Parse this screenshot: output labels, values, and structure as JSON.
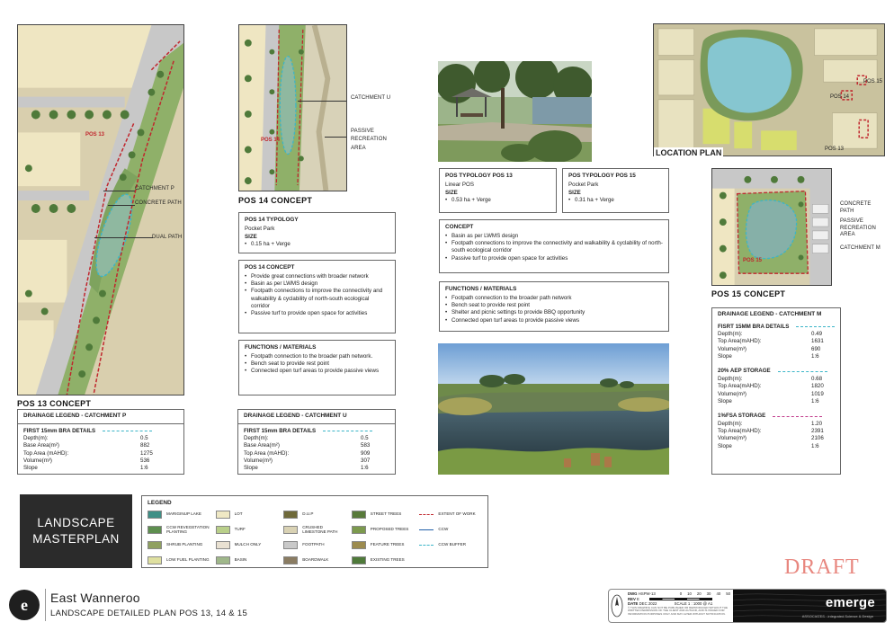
{
  "pos13": {
    "title": "POS 13 CONCEPT",
    "tag": "POS 13",
    "callouts": [
      "CATCHMENT P",
      "CONCRETE PATH",
      "DUAL PATH"
    ]
  },
  "pos14": {
    "title": "POS 14 CONCEPT",
    "tag": "POS 14",
    "callouts": [
      "CATCHMENT U",
      "PASSIVE RECREATION AREA"
    ],
    "typology": {
      "heading": "POS 14 TYPOLOGY",
      "type": "Pocket Park",
      "size_label": "SIZE",
      "size": "0.15 ha + Verge"
    },
    "concept": {
      "heading": "POS 14 CONCEPT",
      "items": [
        "Provide great connections with broader network",
        "Basin as per LWMS design",
        "Footpath connections to improve the connectivity and walkability & cyclability of north-south ecological corridor",
        "Passive turf to provide open space for activities"
      ]
    },
    "functions": {
      "heading": "FUNCTIONS / MATERIALS",
      "items": [
        "Footpath connection to the broader path network.",
        "Bench seat to provide rest point",
        "Connected open turf areas to provide passive views"
      ]
    }
  },
  "drainage_p": {
    "heading": "DRAINAGE LEGEND - CATCHMENT P",
    "sections": [
      {
        "title": "FIRST 15mm BRA DETAILS",
        "rows": [
          {
            "k": "Depth(m):",
            "v": "0.5"
          },
          {
            "k": "Base Area(m²)",
            "v": "882"
          },
          {
            "k": "Top Area (mAHD):",
            "v": "1275"
          },
          {
            "k": "Volume(m³)",
            "v": "536"
          },
          {
            "k": "Slope",
            "v": "1:6"
          }
        ]
      }
    ]
  },
  "drainage_u": {
    "heading": "DRAINAGE LEGEND - CATCHMENT U",
    "sections": [
      {
        "title": "FIRST 15mm BRA DETAILS",
        "rows": [
          {
            "k": "Depth(m):",
            "v": "0.5"
          },
          {
            "k": "Base Area(m²)",
            "v": "583"
          },
          {
            "k": "Top Area (mAHD):",
            "v": "909"
          },
          {
            "k": "Volume(m³)",
            "v": "307"
          },
          {
            "k": "Slope",
            "v": "1:6"
          }
        ]
      }
    ]
  },
  "typology13": {
    "heading": "POS TYPOLOGY POS 13",
    "type": "Linear POS",
    "size_label": "SIZE",
    "size": "0.53 ha + Verge"
  },
  "typology15": {
    "heading": "POS TYPOLOGY POS 15",
    "type": "Pocket Park",
    "size_label": "SIZE",
    "size": "0.31 ha + Verge"
  },
  "concept_shared": {
    "heading": "CONCEPT",
    "items": [
      "Basin as per LWMS design",
      "Footpath connections to improve the connectivity and walkability & cyclability of north-south ecological corridor",
      "Passive turf to provide open space for activities"
    ]
  },
  "functions_shared": {
    "heading": "FUNCTIONS / MATERIALS",
    "items": [
      "Footpath connection to the broader path network",
      "Bench seat to provide rest point",
      "Shelter and picnic settings to provide BBQ opportunity",
      "Connected open turf areas to provide passive views"
    ]
  },
  "location": {
    "title": "LOCATION PLAN",
    "tags": [
      "POS 15",
      "POS 14",
      "POS 13"
    ]
  },
  "pos15": {
    "title": "POS 15 CONCEPT",
    "tag": "POS 15",
    "callouts": [
      "CONCRETE PATH",
      "PASSIVE RECREATION AREA",
      "CATCHMENT M"
    ]
  },
  "drainage_m": {
    "heading": "DRAINAGE LEGEND - CATCHMENT M",
    "sections": [
      {
        "title": "FISRT 15MM BRA DETAILS",
        "style": "cyan",
        "rows": [
          {
            "k": "Depth(m):",
            "v": "0.49"
          },
          {
            "k": "Top Area(mAHD):",
            "v": "1631"
          },
          {
            "k": "Volume(m³)",
            "v": "690"
          },
          {
            "k": "Slope",
            "v": "1:6"
          }
        ]
      },
      {
        "title": "20% AEP STORAGE",
        "style": "cyan",
        "rows": [
          {
            "k": "Depth(m):",
            "v": "0.68"
          },
          {
            "k": "Top Area(mAHD):",
            "v": "1820"
          },
          {
            "k": "Volume(m³)",
            "v": "1019"
          },
          {
            "k": "Slope",
            "v": "1:6"
          }
        ]
      },
      {
        "title": "1%FSA STORAGE",
        "style": "pink",
        "rows": [
          {
            "k": "Depth(m):",
            "v": "1.20"
          },
          {
            "k": "Top Area(mAHD):",
            "v": "2391"
          },
          {
            "k": "Volume(m³)",
            "v": "2106"
          },
          {
            "k": "Slope",
            "v": "1:6"
          }
        ]
      }
    ]
  },
  "banner": {
    "line1": "LANDSCAPE",
    "line2": "MASTERPLAN"
  },
  "legend": {
    "title": "LEGEND",
    "items": [
      {
        "label": "MARIGINUP LAKE",
        "color": "#3f8f86",
        "kind": "swatch"
      },
      {
        "label": "LOT",
        "color": "#efe8c4",
        "kind": "swatch"
      },
      {
        "label": "D.U.P",
        "color": "#6f6a3a",
        "kind": "swatch"
      },
      {
        "label": "STREET TREES",
        "color": "#587a3a",
        "kind": "swatch"
      },
      {
        "label": "EXTENT OF WORK",
        "color": "#c0262d",
        "kind": "line-red"
      },
      {
        "label": "CCW REVEGETATION PLANTING",
        "color": "#5e8f4f",
        "kind": "swatch"
      },
      {
        "label": "TURF",
        "color": "#b9cf8a",
        "kind": "swatch"
      },
      {
        "label": "CRUSHED LIMESTONE PATH",
        "color": "#d9d2b4",
        "kind": "swatch"
      },
      {
        "label": "PROPOSED TREES",
        "color": "#7c9a4e",
        "kind": "swatch"
      },
      {
        "label": "CCW",
        "color": "#1f5ea8",
        "kind": "line-blue"
      },
      {
        "label": "SHRUB PLANTING",
        "color": "#8fa060",
        "kind": "swatch"
      },
      {
        "label": "MULCH ONLY",
        "color": "#e9e1d2",
        "kind": "swatch"
      },
      {
        "label": "FOOTPATH",
        "color": "#c9c9c9",
        "kind": "swatch"
      },
      {
        "label": "FEATURE TREES",
        "color": "#9c8b4e",
        "kind": "swatch"
      },
      {
        "label": "CCW BUFFER",
        "color": "#3bb5c8",
        "kind": "line-cyan"
      },
      {
        "label": "LOW FUEL PLANTING",
        "color": "#dfe0a0",
        "kind": "swatch"
      },
      {
        "label": "BASIN",
        "color": "#9fb78a",
        "kind": "swatch"
      },
      {
        "label": "BOARDWALK",
        "color": "#8a7c62",
        "kind": "swatch"
      },
      {
        "label": "EXISTING TREES",
        "color": "#4f7a3a",
        "kind": "swatch"
      }
    ]
  },
  "draft": "DRAFT",
  "footer": {
    "logo": "e",
    "title": "East Wanneroo",
    "subtitle": "LANDSCAPE DETAILED PLAN POS 13, 14 & 15"
  },
  "titleblock": {
    "dwg_label": "DWG",
    "dwg": "HSPW-13",
    "rev_label": "REV",
    "rev": "E",
    "date_label": "DATE",
    "date": "DEC 2022",
    "scale": "SCALE 1 : 1000 @ A1",
    "scale_ticks": [
      "0",
      "10",
      "20",
      "30",
      "40",
      "50"
    ],
    "note": "© THIS DRAWING CAN NOT BE PUBLISHED OR REPRODUCED WITHOUT THE WRITTEN PERMISSION OF THE CLIENT AND AUTHOR, AND IS ISSUED FOR INFORMATION PURPOSES ONLY AND MAY ALTER WITHOUT NOTIFICATION.",
    "brand": "emerge",
    "brand_tag": "ASSOCIATES · integrated Science & Design"
  },
  "colors": {
    "extent_red": "#c0262d",
    "buffer_cyan": "#3bb5c8",
    "storage_pink": "#c0398a",
    "banner_dark": "#2b2b2b",
    "draft_salmon": "#e8877f"
  }
}
